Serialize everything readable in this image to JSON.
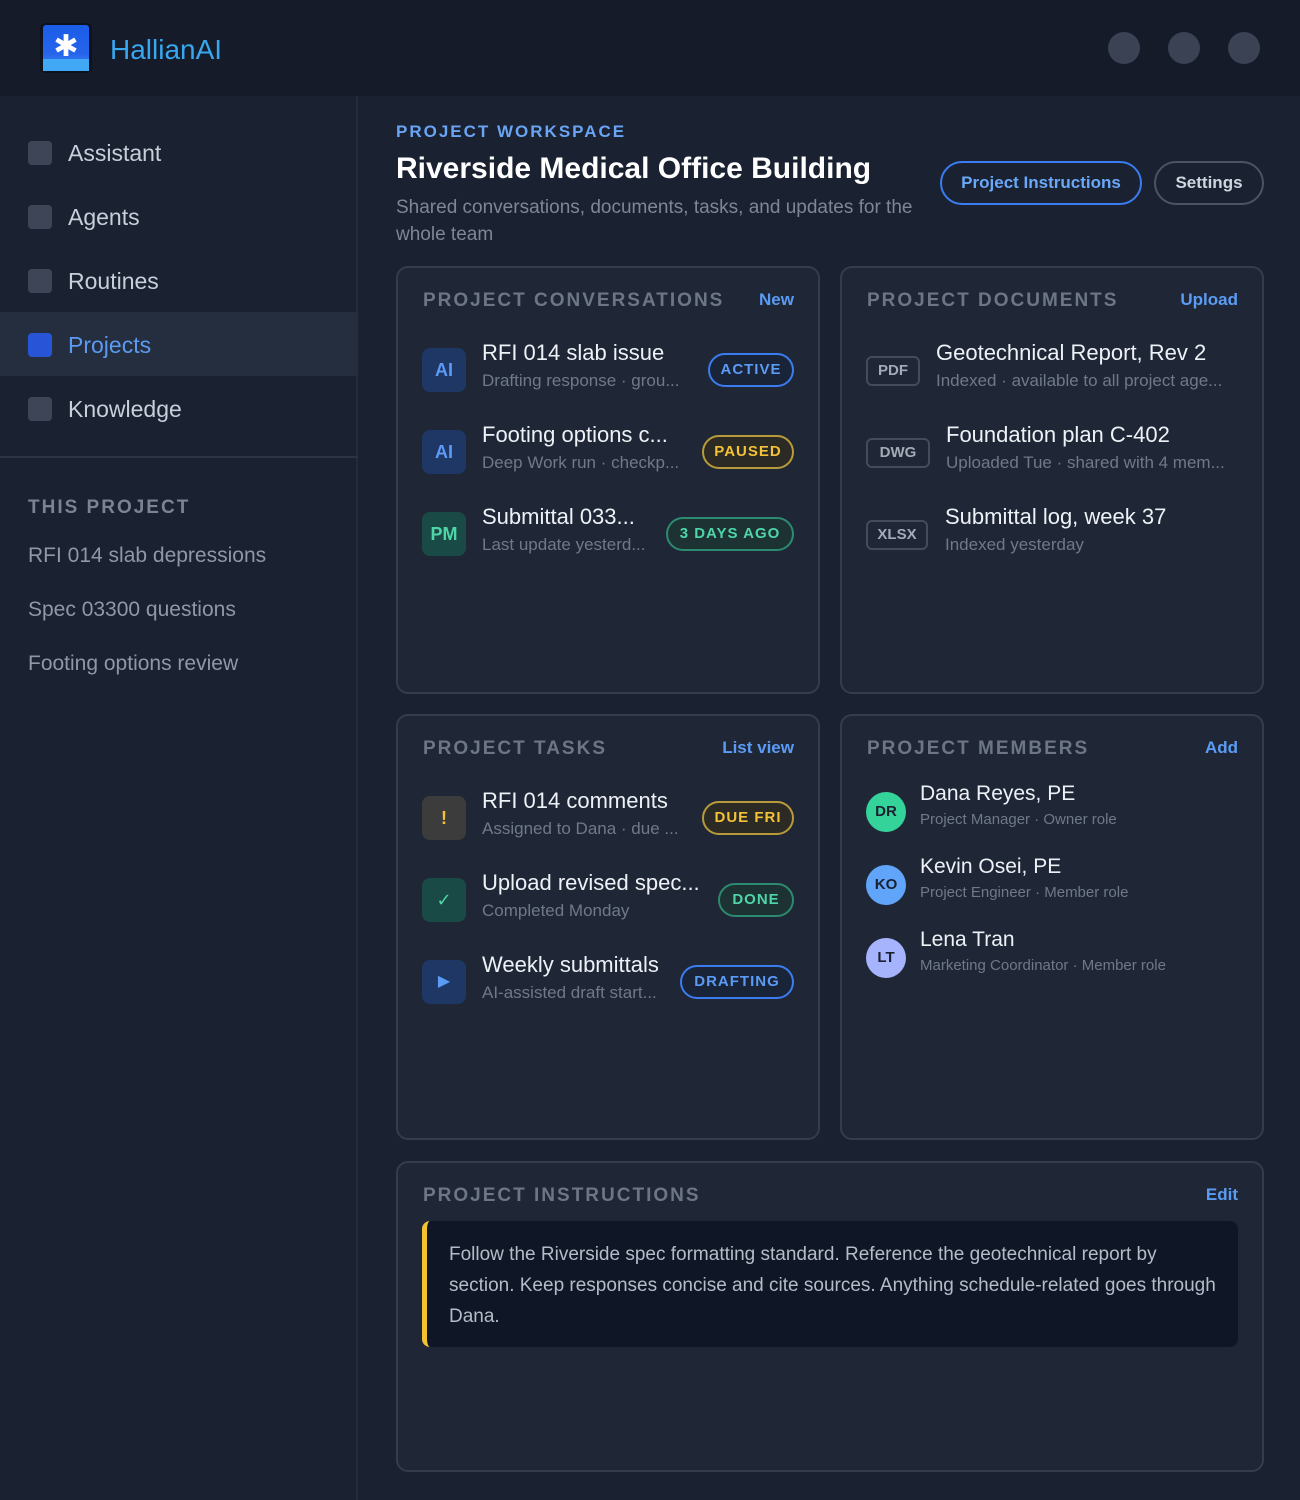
{
  "app": {
    "brand": "HallianAI"
  },
  "sidebar": {
    "items": [
      {
        "label": "Assistant",
        "active": false
      },
      {
        "label": "Agents",
        "active": false
      },
      {
        "label": "Routines",
        "active": false
      },
      {
        "label": "Projects",
        "active": true
      },
      {
        "label": "Knowledge",
        "active": false
      }
    ],
    "section_heading": "THIS PROJECT",
    "project_links": [
      "RFI 014 slab depressions",
      "Spec 03300 questions",
      "Footing options review"
    ]
  },
  "header": {
    "eyebrow": "PROJECT WORKSPACE",
    "title": "Riverside Medical Office Building",
    "subtitle": "Shared conversations, documents, tasks, and updates for the whole team",
    "primary_button": "Project Instructions",
    "secondary_button": "Settings"
  },
  "conversations": {
    "heading": "PROJECT CONVERSATIONS",
    "action": "New",
    "items": [
      {
        "avatar": "AI",
        "title": "RFI 014 slab issue",
        "subtitle": "Drafting response · grou...",
        "status": "ACTIVE"
      },
      {
        "avatar": "AI",
        "title": "Footing options c...",
        "subtitle": "Deep Work run · checkp...",
        "status": "PAUSED"
      },
      {
        "avatar": "PM",
        "title": "Submittal 033...",
        "subtitle": "Last update yesterd...",
        "status": "3 DAYS AGO"
      }
    ]
  },
  "documents": {
    "heading": "PROJECT DOCUMENTS",
    "action": "Upload",
    "items": [
      {
        "type": "PDF",
        "title": "Geotechnical Report, Rev 2",
        "subtitle": "Indexed · available to all project age..."
      },
      {
        "type": "DWG",
        "title": "Foundation plan C-402",
        "subtitle": "Uploaded Tue · shared with 4 mem..."
      },
      {
        "type": "XLSX",
        "title": "Submittal log, week 37",
        "subtitle": "Indexed yesterday"
      }
    ]
  },
  "tasks": {
    "heading": "PROJECT TASKS",
    "action": "List view",
    "items": [
      {
        "icon": "!",
        "title": "RFI 014 comments",
        "subtitle": "Assigned to Dana · due ...",
        "status": "DUE FRI"
      },
      {
        "icon": "✓",
        "title": "Upload revised spec...",
        "subtitle": "Completed Monday",
        "status": "DONE"
      },
      {
        "icon": "▶",
        "title": "Weekly submittals",
        "subtitle": "AI-assisted draft start...",
        "status": "DRAFTING"
      }
    ]
  },
  "members": {
    "heading": "PROJECT MEMBERS",
    "action": "Add",
    "items": [
      {
        "initials": "DR",
        "name": "Dana Reyes, PE",
        "role": "Project Manager · Owner role",
        "color": "#34d399"
      },
      {
        "initials": "KO",
        "name": "Kevin Osei, PE",
        "role": "Project Engineer · Member role",
        "color": "#60a5fa"
      },
      {
        "initials": "LT",
        "name": "Lena Tran",
        "role": "Marketing Coordinator · Member role",
        "color": "#a5b4fc"
      }
    ]
  },
  "instructions": {
    "heading": "PROJECT INSTRUCTIONS",
    "action": "Edit",
    "text": "Follow the Riverside spec formatting standard. Reference the geotechnical report by section. Keep responses concise and cite sources. Anything schedule-related goes through Dana."
  },
  "colors": {
    "accent": "#3b7cf0",
    "brand": "#38a7f0",
    "success": "#4fd5a8",
    "warning": "#f3c236",
    "background": "#1a2130"
  }
}
